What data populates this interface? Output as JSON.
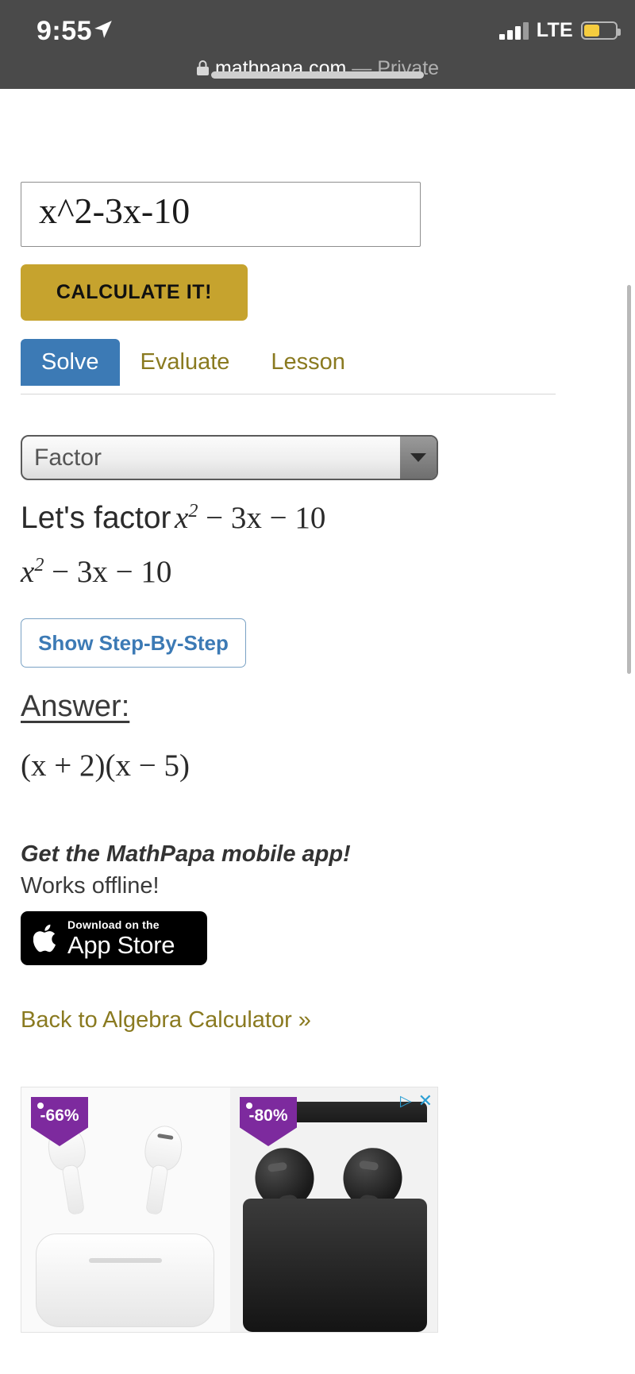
{
  "status_bar": {
    "time": "9:55",
    "location_icon": "location-arrow-icon",
    "signal_label": "LTE",
    "signal_bars_filled": 3,
    "signal_bars_total": 4,
    "battery_percent": 50,
    "battery_color": "#f5cc3f"
  },
  "browser": {
    "lock_icon": "lock-icon",
    "host": "mathpapa.com",
    "separator": " — ",
    "private_label": "Private"
  },
  "calculator": {
    "expression_input": "x^2-3x-10",
    "calculate_label": "CALCULATE IT!",
    "tabs": [
      {
        "label": "Solve",
        "active": true
      },
      {
        "label": "Evaluate",
        "active": false
      },
      {
        "label": "Lesson",
        "active": false
      }
    ],
    "operation_select": {
      "value": "Factor",
      "arrow_icon": "chevron-down-icon"
    },
    "intro_label": "Let's factor",
    "intro_expression": {
      "base": "x",
      "exp": "2",
      "rest": " − 3x − 10"
    },
    "restate_expression": {
      "base": "x",
      "exp": "2",
      "rest": " − 3x − 10"
    },
    "step_by_step_label": "Show Step-By-Step",
    "answer_heading": "Answer:",
    "answer_expression": "(x + 2)(x − 5)"
  },
  "promo": {
    "headline": "Get the MathPapa mobile app!",
    "subline": "Works offline!",
    "app_store": {
      "apple_icon": "apple-logo-icon",
      "line1": "Download on the",
      "line2": "App Store"
    },
    "back_link": "Back to Algebra Calculator »"
  },
  "ad": {
    "adchoices_icon": "adchoices-icon",
    "close_icon": "close-icon",
    "left_discount": "-66%",
    "right_discount": "-80%"
  },
  "colors": {
    "accent_gold": "#c6a32e",
    "accent_blue": "#3c7ab5",
    "link_gold": "#8a7a20",
    "status_bg": "#4a4a4a"
  }
}
